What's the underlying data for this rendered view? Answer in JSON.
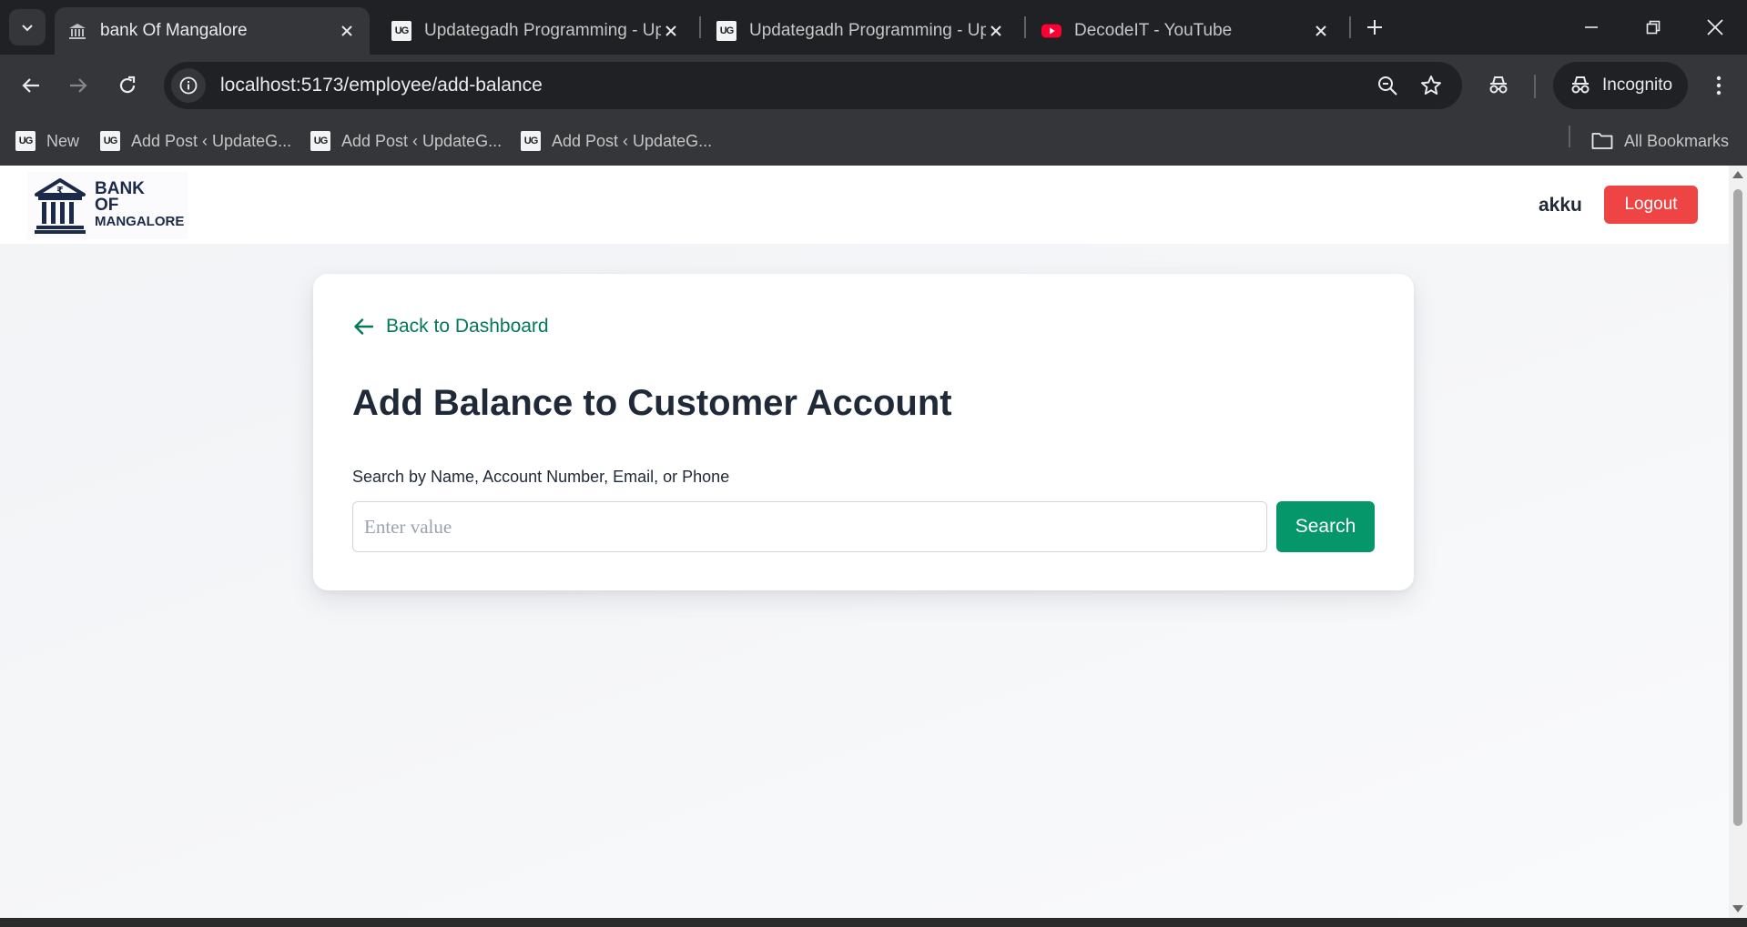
{
  "browser": {
    "tabs": [
      {
        "title": "bank Of Mangalore",
        "active": true,
        "icon": "bank-favicon"
      },
      {
        "title": "Updategadh Programming - Up",
        "active": false,
        "icon": "ug-favicon"
      },
      {
        "title": "Updategadh Programming - Up",
        "active": false,
        "icon": "ug-favicon"
      },
      {
        "title": "DecodeIT - YouTube",
        "active": false,
        "icon": "youtube-favicon"
      }
    ],
    "url": "localhost:5173/employee/add-balance",
    "profile_label": "Incognito",
    "bookmarks": [
      {
        "label": "New"
      },
      {
        "label": "Add Post ‹ UpdateG..."
      },
      {
        "label": "Add Post ‹ UpdateG..."
      },
      {
        "label": "Add Post ‹ UpdateG..."
      }
    ],
    "all_bookmarks_label": "All Bookmarks",
    "ug_glyph": "UG"
  },
  "app": {
    "logo": {
      "line1": "BANK",
      "line2": "OF",
      "line3": "MANGALORE"
    },
    "username": "akku",
    "logout_label": "Logout"
  },
  "page": {
    "back_label": "Back to Dashboard",
    "title": "Add Balance to Customer Account",
    "search_label": "Search by Name, Account Number, Email, or Phone",
    "search_placeholder": "Enter value",
    "search_value": "",
    "search_button": "Search"
  },
  "colors": {
    "accent_green": "#047857",
    "button_green": "#059669",
    "logout_red": "#ef4444",
    "brand_navy": "#1c2a4a"
  }
}
